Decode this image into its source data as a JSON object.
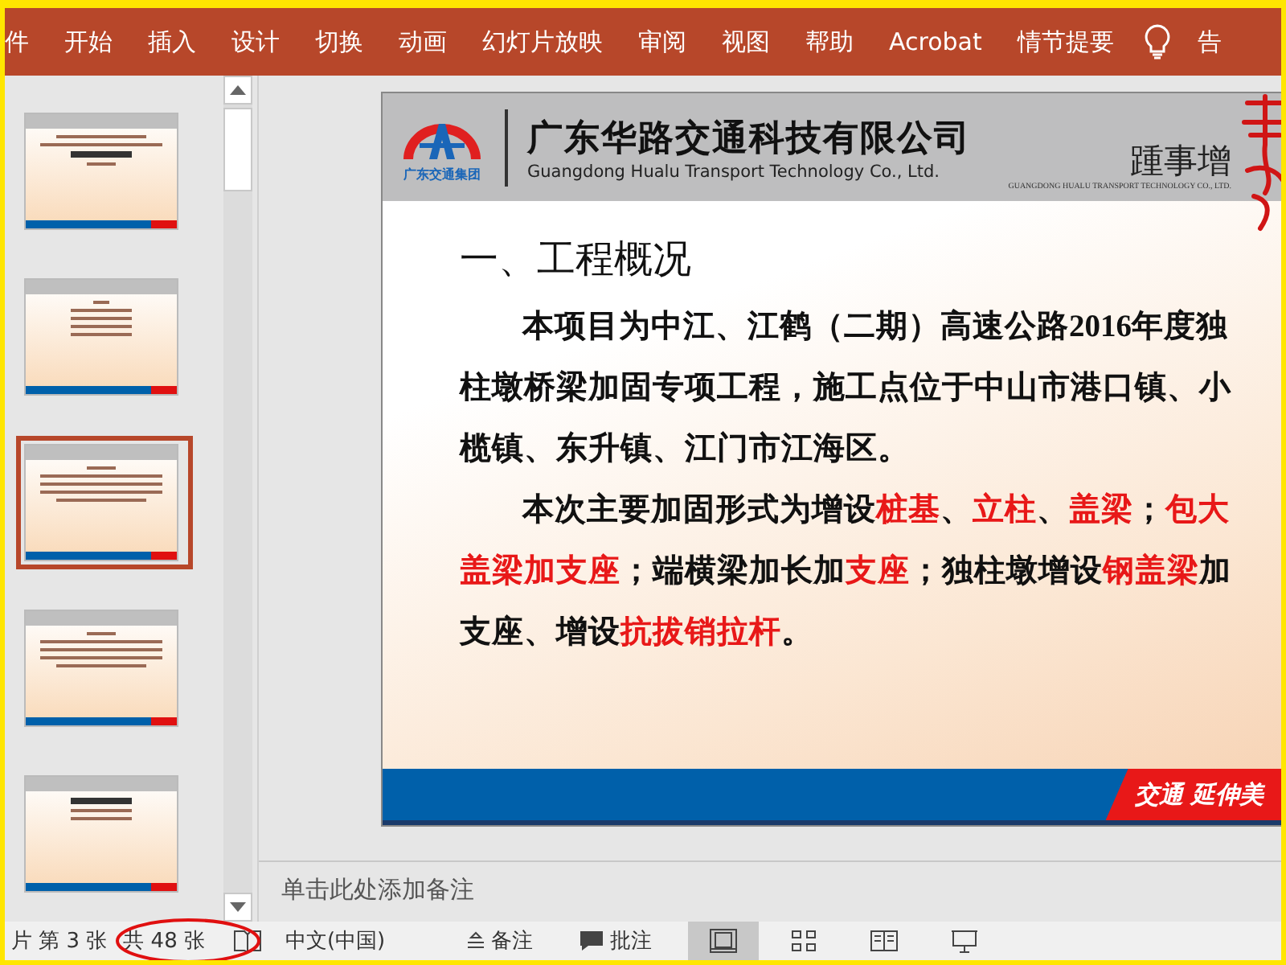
{
  "ribbon": {
    "tabs": [
      {
        "label": "件",
        "selected": false
      },
      {
        "label": "开始",
        "selected": false
      },
      {
        "label": "插入",
        "selected": false
      },
      {
        "label": "设计",
        "selected": false
      },
      {
        "label": "切换",
        "selected": false
      },
      {
        "label": "动画",
        "selected": false
      },
      {
        "label": "幻灯片放映",
        "selected": false
      },
      {
        "label": "审阅",
        "selected": false
      },
      {
        "label": "视图",
        "selected": false
      },
      {
        "label": "帮助",
        "selected": false
      },
      {
        "label": "Acrobat",
        "selected": false
      },
      {
        "label": "情节提要",
        "selected": false
      }
    ],
    "tell_me": "告"
  },
  "thumbnails": [
    {
      "kind": "title",
      "selected": false
    },
    {
      "kind": "list",
      "selected": false
    },
    {
      "kind": "text",
      "selected": true
    },
    {
      "kind": "text",
      "selected": false
    },
    {
      "kind": "section",
      "selected": false
    }
  ],
  "slide": {
    "group_name": "广东交通集团",
    "company_cn": "广东华路交通科技有限公司",
    "company_en": "Guangdong Hualu Transport Technology Co., Ltd.",
    "slogan_cn": "踵事增",
    "slogan_en": "GUANGDONG HUALU TRANSPORT TECHNOLOGY CO., LTD.",
    "heading": "一、工程概况",
    "paragraphs": [
      [
        {
          "text": "本项目为中江、江鹤（二期）高速公路2016年度独柱墩桥梁加固专项工程，施工点位于中山市港口镇、小榄镇、东升镇、江门市江海区。",
          "highlight": false
        }
      ],
      [
        {
          "text": "本次主要加固形式为增设",
          "highlight": false
        },
        {
          "text": "桩基",
          "highlight": true
        },
        {
          "text": "、",
          "highlight": false
        },
        {
          "text": "立柱",
          "highlight": true
        },
        {
          "text": "、",
          "highlight": false
        },
        {
          "text": "盖梁",
          "highlight": true
        },
        {
          "text": "；",
          "highlight": false
        },
        {
          "text": "包大盖梁加支座",
          "highlight": true
        },
        {
          "text": "；端横梁加长加",
          "highlight": false
        },
        {
          "text": "支座",
          "highlight": true
        },
        {
          "text": "；独柱墩增设",
          "highlight": false
        },
        {
          "text": "钢盖梁",
          "highlight": true
        },
        {
          "text": "加支座、增设",
          "highlight": false
        },
        {
          "text": "抗拔销拉杆",
          "highlight": true
        },
        {
          "text": "。",
          "highlight": false
        }
      ]
    ],
    "footer": "交通 延伸美"
  },
  "notes_placeholder": "单击此处添加备注",
  "status_bar": {
    "slide_position": "片 第 3 张",
    "slide_count": "共 48 张",
    "language": "中文(中国)",
    "notes": "备注",
    "comments": "批注",
    "views": [
      {
        "kind": "normal",
        "selected": true
      },
      {
        "kind": "sorter",
        "selected": false
      },
      {
        "kind": "reading",
        "selected": false
      },
      {
        "kind": "slideshow",
        "selected": false
      }
    ]
  }
}
